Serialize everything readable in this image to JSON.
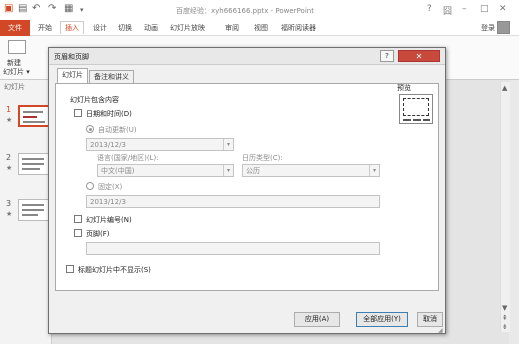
{
  "app": {
    "doc_title": "百度经验：xyh666166.pptx - PowerPoint",
    "window_buttons": [
      "?",
      "囧",
      "–",
      "□",
      "✕"
    ]
  },
  "ribbon": {
    "file_tab": "文件",
    "tabs": [
      "开始",
      "插入",
      "设计",
      "切换",
      "动画",
      "幻灯片放映",
      "审阅",
      "视图",
      "福昕阅读器"
    ],
    "active_tab": "插入",
    "login": "登录"
  },
  "slide_pane": {
    "new_slide_line1": "新建",
    "new_slide_line2": "幻灯片 ▾",
    "group_label": "幻灯片",
    "numbers": [
      "1",
      "2",
      "3"
    ],
    "star": "★"
  },
  "dialog": {
    "title": "页眉和页脚",
    "help": "?",
    "close": "✕",
    "tabs": [
      "幻灯片",
      "备注和讲义"
    ],
    "active_tab": "幻灯片",
    "section_title": "幻灯片包含内容",
    "date_time": {
      "label": "日期和时间(D)",
      "checked": false,
      "auto_update_label": "自动更新(U)",
      "auto_update_selected": true,
      "auto_value": "2013/12/3",
      "language_label": "语言(国家/地区)(L):",
      "language_value": "中文(中国)",
      "calendar_label": "日历类型(C):",
      "calendar_value": "公历",
      "fixed_label": "固定(X)",
      "fixed_value": "2013/12/3"
    },
    "slide_number": {
      "label": "幻灯片编号(N)",
      "checked": false
    },
    "footer": {
      "label": "页脚(F)",
      "checked": false,
      "value": ""
    },
    "no_title_slide": {
      "label": "标题幻灯片中不显示(S)",
      "checked": false
    },
    "preview_label": "预览",
    "buttons": {
      "apply": "应用(A)",
      "apply_all": "全部应用(Y)",
      "cancel": "取消"
    }
  },
  "scroll": {
    "up": "▲",
    "down": "▼",
    "prev": "⇞",
    "next": "⇟"
  }
}
